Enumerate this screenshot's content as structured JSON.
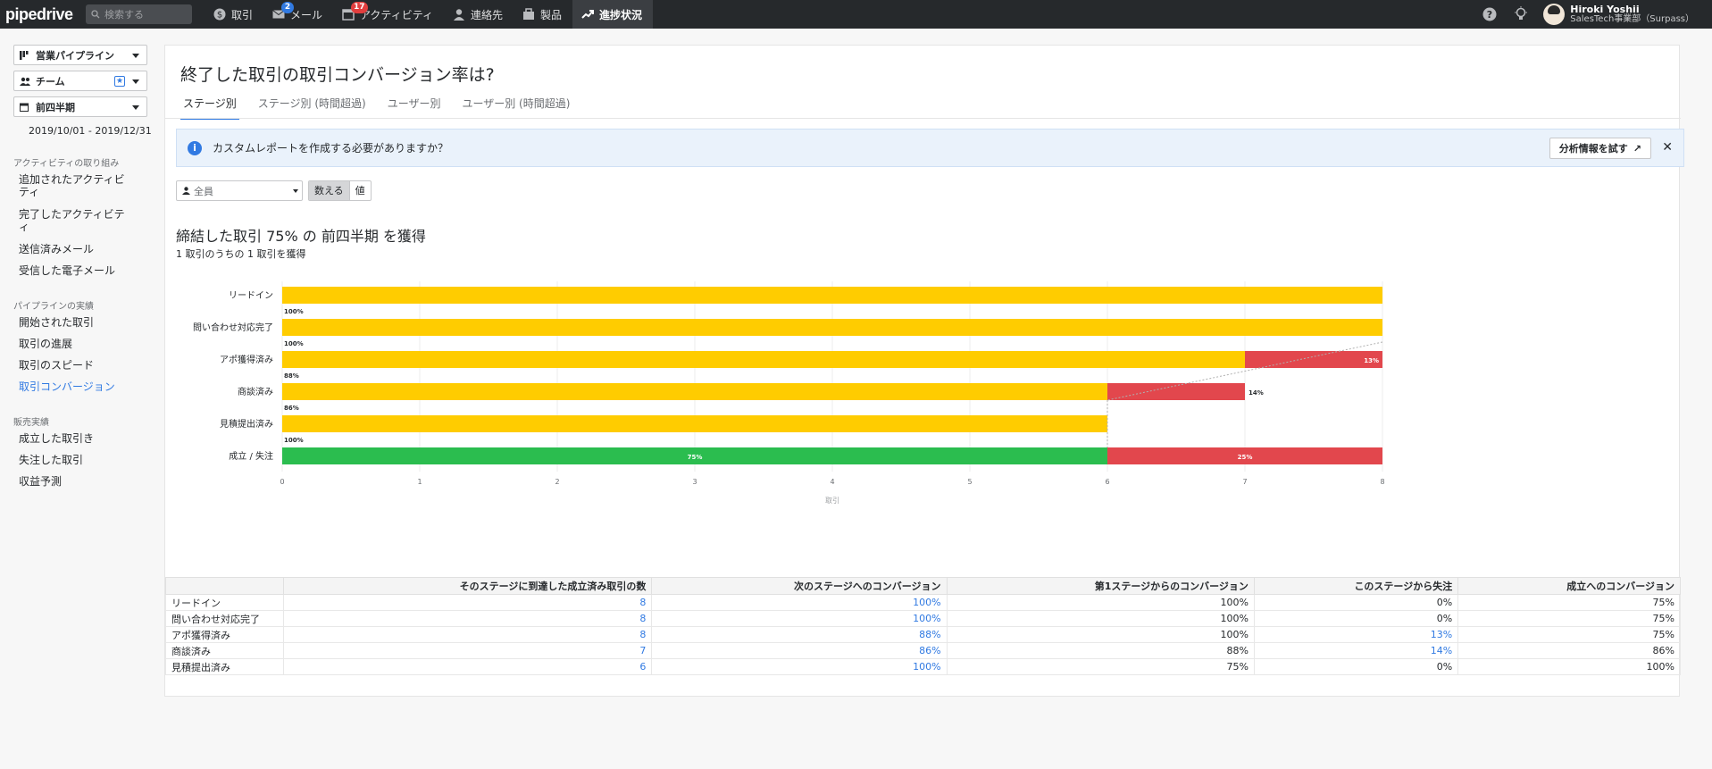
{
  "topbar": {
    "logo": "pipedrive",
    "search_placeholder": "検索する",
    "nav": [
      {
        "label": "取引",
        "icon": "dollar-icon"
      },
      {
        "label": "メール",
        "icon": "mail-icon",
        "badge": "2"
      },
      {
        "label": "アクティビティ",
        "icon": "calendar-icon",
        "badge": "17"
      },
      {
        "label": "連絡先",
        "icon": "person-icon"
      },
      {
        "label": "製品",
        "icon": "box-icon"
      },
      {
        "label": "進捗状況",
        "icon": "trend-icon"
      }
    ],
    "user_name": "Hiroki Yoshii",
    "user_org": "SalesTech事業部（Surpass）"
  },
  "sidebar": {
    "pipeline": "営業パイプライン",
    "team": "チーム",
    "period": "前四半期",
    "date_range": "2019/10/01 - 2019/12/31",
    "sections": [
      {
        "title": "アクティビティの取り組み",
        "items": [
          "追加されたアクティビティ",
          "完了したアクティビティ",
          "送信済みメール",
          "受信した電子メール"
        ]
      },
      {
        "title": "パイプラインの実績",
        "items": [
          "開始された取引",
          "取引の進展",
          "取引のスピード",
          "取引コンバージョン"
        ]
      },
      {
        "title": "販売実績",
        "items": [
          "成立した取引き",
          "失注した取引",
          "収益予測"
        ]
      }
    ]
  },
  "main": {
    "title": "終了した取引の取引コンバージョン率は?",
    "tabs": [
      "ステージ別",
      "ステージ別 (時間超過)",
      "ユーザー別",
      "ユーザー別 (時間超過)"
    ],
    "info_text": "カスタムレポートを作成する必要がありますか？",
    "info_button": "分析情報を試す",
    "owner_filter": "全員",
    "toggle": [
      "数える",
      "値"
    ],
    "headline": "締結した取引 75% の 前四半期 を獲得",
    "subline": "1 取引のうちの 1 取引を獲得"
  },
  "colors": {
    "accent": "#317ae2",
    "stage_bar": "#ffcc00",
    "lost": "#e2474d",
    "won": "#2bbd4f"
  },
  "chart_data": {
    "type": "bar",
    "orientation": "horizontal",
    "stacked": true,
    "categories": [
      "リードイン",
      "問い合わせ対応完了",
      "アポ獲得済み",
      "商談済み",
      "見積提出済み",
      "成立 / 失注"
    ],
    "series": [
      {
        "values": [
          8,
          8,
          7,
          6,
          6,
          6
        ],
        "color": "#ffcc00"
      },
      {
        "values": [
          0,
          0,
          1,
          1,
          0,
          2
        ],
        "color": "#e2474d"
      }
    ],
    "final_won_color": "#2bbd4f",
    "conversion_labels": [
      "100%",
      "100%",
      "88%",
      "86%",
      "100%"
    ],
    "segment_labels": [
      {
        "category": "アポ獲得済み",
        "text": "13%"
      },
      {
        "category": "商談済み",
        "text": "14%"
      },
      {
        "category": "成立 / 失注",
        "text": "75%"
      },
      {
        "category": "成立 / 失注",
        "text": "25%"
      }
    ],
    "xlim": [
      0,
      8
    ],
    "xticks": [
      "0",
      "1",
      "2",
      "3",
      "4",
      "5",
      "6",
      "7",
      "8"
    ],
    "xlabel": "取引",
    "grid": true
  },
  "table": {
    "headers": [
      "",
      "そのステージに到達した成立済み取引の数",
      "次のステージへのコンバージョン",
      "第1ステージからのコンバージョン",
      "このステージから失注",
      "成立へのコンバージョン"
    ],
    "rows": [
      [
        "リードイン",
        "8",
        "100%",
        "100%",
        "0%",
        "75%"
      ],
      [
        "問い合わせ対応完了",
        "8",
        "100%",
        "100%",
        "0%",
        "75%"
      ],
      [
        "アポ獲得済み",
        "8",
        "88%",
        "100%",
        "13%",
        "75%"
      ],
      [
        "商談済み",
        "7",
        "86%",
        "88%",
        "14%",
        "86%"
      ],
      [
        "見積提出済み",
        "6",
        "100%",
        "75%",
        "0%",
        "100%"
      ]
    ]
  }
}
